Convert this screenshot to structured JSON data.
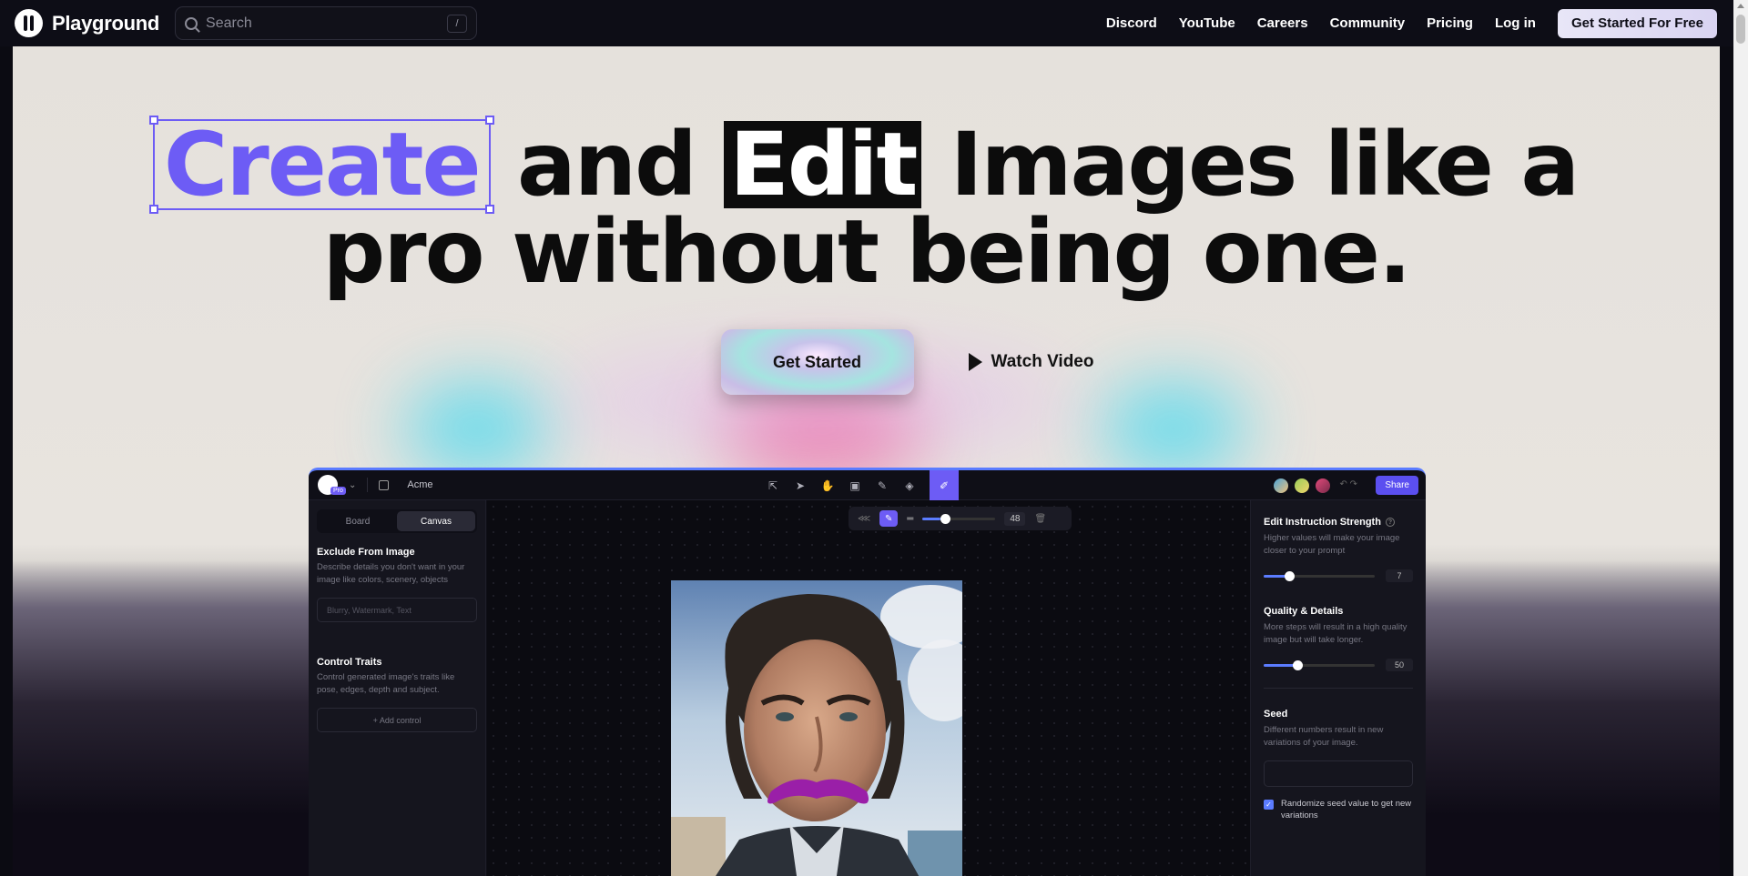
{
  "nav": {
    "brand": "Playground",
    "search_placeholder": "Search",
    "search_shortcut": "/",
    "links": [
      "Discord",
      "YouTube",
      "Careers",
      "Community",
      "Pricing",
      "Log in"
    ],
    "cta": "Get Started For Free"
  },
  "hero": {
    "headline_word_create": "Create",
    "headline_and": "and",
    "headline_word_edit": "Edit",
    "headline_rest_line1": "Images like a",
    "headline_line2": "pro without being one.",
    "primary_cta": "Get Started",
    "secondary_cta": "Watch Video"
  },
  "app": {
    "badge": "Pro",
    "project_name": "Acme",
    "share_label": "Share",
    "brush_size": "48",
    "brush_size_fraction": 0.25,
    "tabs": [
      "Board",
      "Canvas"
    ],
    "active_tab": "Canvas",
    "left_panel": {
      "exclude_title": "Exclude From Image",
      "exclude_desc": "Describe details you don't want in your image like colors, scenery, objects",
      "exclude_placeholder": "Blurry, Watermark, Text",
      "traits_title": "Control Traits",
      "traits_desc": "Control generated image's traits like pose, edges, depth and subject.",
      "add_control": "+ Add control"
    },
    "right_panel": {
      "strength_title": "Edit Instruction Strength",
      "strength_desc": "Higher values will make your image closer to your prompt",
      "strength_value": "7",
      "strength_fraction": 0.23,
      "quality_title": "Quality & Details",
      "quality_desc": "More steps will result in a high quality image but will take longer.",
      "quality_value": "50",
      "quality_fraction": 0.3,
      "seed_title": "Seed",
      "seed_desc": "Different numbers result in new variations of your image.",
      "randomize_label": "Randomize seed value to get new variations"
    }
  },
  "colors": {
    "accent": "#6d5cf5",
    "share": "#5b4ff0",
    "slider": "#5b7cff"
  }
}
